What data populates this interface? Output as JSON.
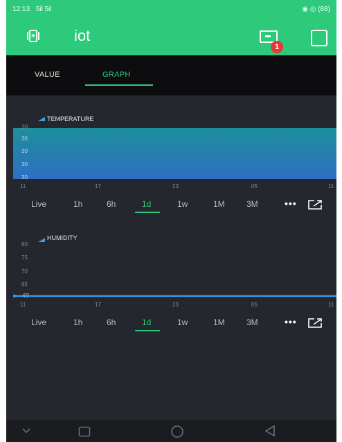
{
  "status_bar": {
    "time": "12:13",
    "left_extra": "5il 5il",
    "right_text": "◉ ◎ (88)"
  },
  "app_bar": {
    "title": "iot",
    "badge_count": "1",
    "icons": [
      "device-frame-icon",
      "device-list-icon",
      "square-icon"
    ]
  },
  "tabs": [
    {
      "label": "VALUE",
      "active": false
    },
    {
      "label": "GRAPH",
      "active": true
    }
  ],
  "charts": [
    {
      "legend": "TEMPERATURE",
      "y_ticks": [
        "30",
        "30",
        "30",
        "30",
        "30"
      ],
      "x_ticks": [
        "11",
        "17",
        "23",
        "05",
        "11"
      ],
      "ranges": [
        "Live",
        "1h",
        "6h",
        "1d",
        "1w",
        "1M",
        "3M"
      ],
      "active_range": "1d",
      "more": "•••"
    },
    {
      "legend": "HUMIDITY",
      "y_ticks": [
        "80",
        "75",
        "70",
        "65",
        "60"
      ],
      "x_ticks": [
        "11",
        "17",
        "23",
        "05",
        "11"
      ],
      "ranges": [
        "Live",
        "1h",
        "6h",
        "1d",
        "1w",
        "1M",
        "3M"
      ],
      "active_range": "1d",
      "more": "•••"
    }
  ],
  "chart_data": [
    {
      "type": "area",
      "title": "",
      "series": [
        {
          "name": "TEMPERATURE",
          "values": [
            30,
            30,
            30,
            30,
            30
          ]
        }
      ],
      "categories": [
        "11",
        "17",
        "23",
        "05",
        "11"
      ],
      "ylim": [
        30,
        30
      ],
      "grid": false,
      "colors": {
        "top": "#2f8cd6",
        "bottom": "#13a3a0"
      }
    },
    {
      "type": "line",
      "title": "",
      "series": [
        {
          "name": "HUMIDITY",
          "values": [
            60,
            60,
            60,
            60,
            60
          ]
        }
      ],
      "categories": [
        "11",
        "17",
        "23",
        "05",
        "11"
      ],
      "ylim": [
        60,
        80
      ],
      "grid": false,
      "colors": {
        "line": "#3aa0e8"
      }
    }
  ],
  "colors": {
    "accent": "#2eca7b",
    "background": "#25272e",
    "tab_background": "#0d0d0f",
    "badge": "#e53935"
  },
  "nav_bar": {
    "icons": [
      "chevron-down-icon",
      "recent-apps-icon",
      "home-icon",
      "back-icon"
    ]
  }
}
